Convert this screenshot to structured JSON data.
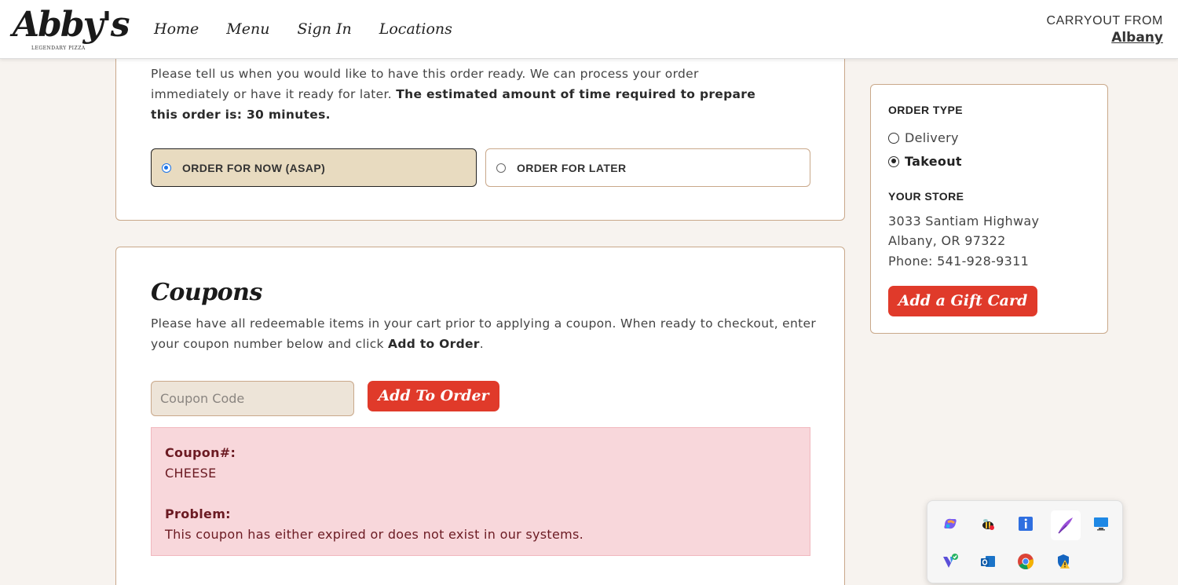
{
  "header": {
    "logo_text": "Abby's",
    "logo_tagline": "LEGENDARY PIZZA",
    "nav": [
      "Home",
      "Menu",
      "Sign In",
      "Locations"
    ],
    "carryout_label": "CARRYOUT FROM",
    "carryout_city": "Albany"
  },
  "time_section": {
    "intro": "Please tell us when you would like to have this order ready. We can process your order immediately or have it ready for later.",
    "estimate": "The estimated amount of time required to prepare this order is: 30 minutes.",
    "option_now": "ORDER FOR NOW (ASAP)",
    "option_later": "ORDER FOR LATER",
    "selected": "now"
  },
  "coupons": {
    "title": "Coupons",
    "desc_pre": "Please have all redeemable items in your cart prior to applying a coupon. When ready to checkout, enter your coupon number below and click ",
    "desc_bold": "Add to Order",
    "desc_post": ".",
    "input_placeholder": "Coupon Code",
    "button_label": "Add To Order",
    "error": {
      "coupon_heading": "Coupon#:",
      "coupon_value": "CHEESE",
      "problem_heading": "Problem:",
      "problem_text": "This coupon has either expired or does not exist in our systems."
    }
  },
  "sidebar": {
    "order_type_heading": "ORDER TYPE",
    "delivery_label": "Delivery",
    "takeout_label": "Takeout",
    "selected": "takeout",
    "store_heading": "YOUR STORE",
    "address_line1": "3033 Santiam Highway",
    "address_line2": "Albany, OR 97322",
    "phone": "Phone: 541-928-9311",
    "gift_button": "Add a Gift Card"
  },
  "tray_icons": [
    "copilot-icon",
    "bee-icon",
    "info-icon",
    "feather-icon",
    "monitor-icon",
    "vpn-check-icon",
    "outlook-icon",
    "chrome-icon",
    "defender-warning-icon"
  ],
  "colors": {
    "accent_red": "#e03a2a",
    "page_bg": "#f7f3ef",
    "card_border": "#c9a88a",
    "selected_option_bg": "#e8dbc0",
    "error_bg": "#f8d7db"
  }
}
